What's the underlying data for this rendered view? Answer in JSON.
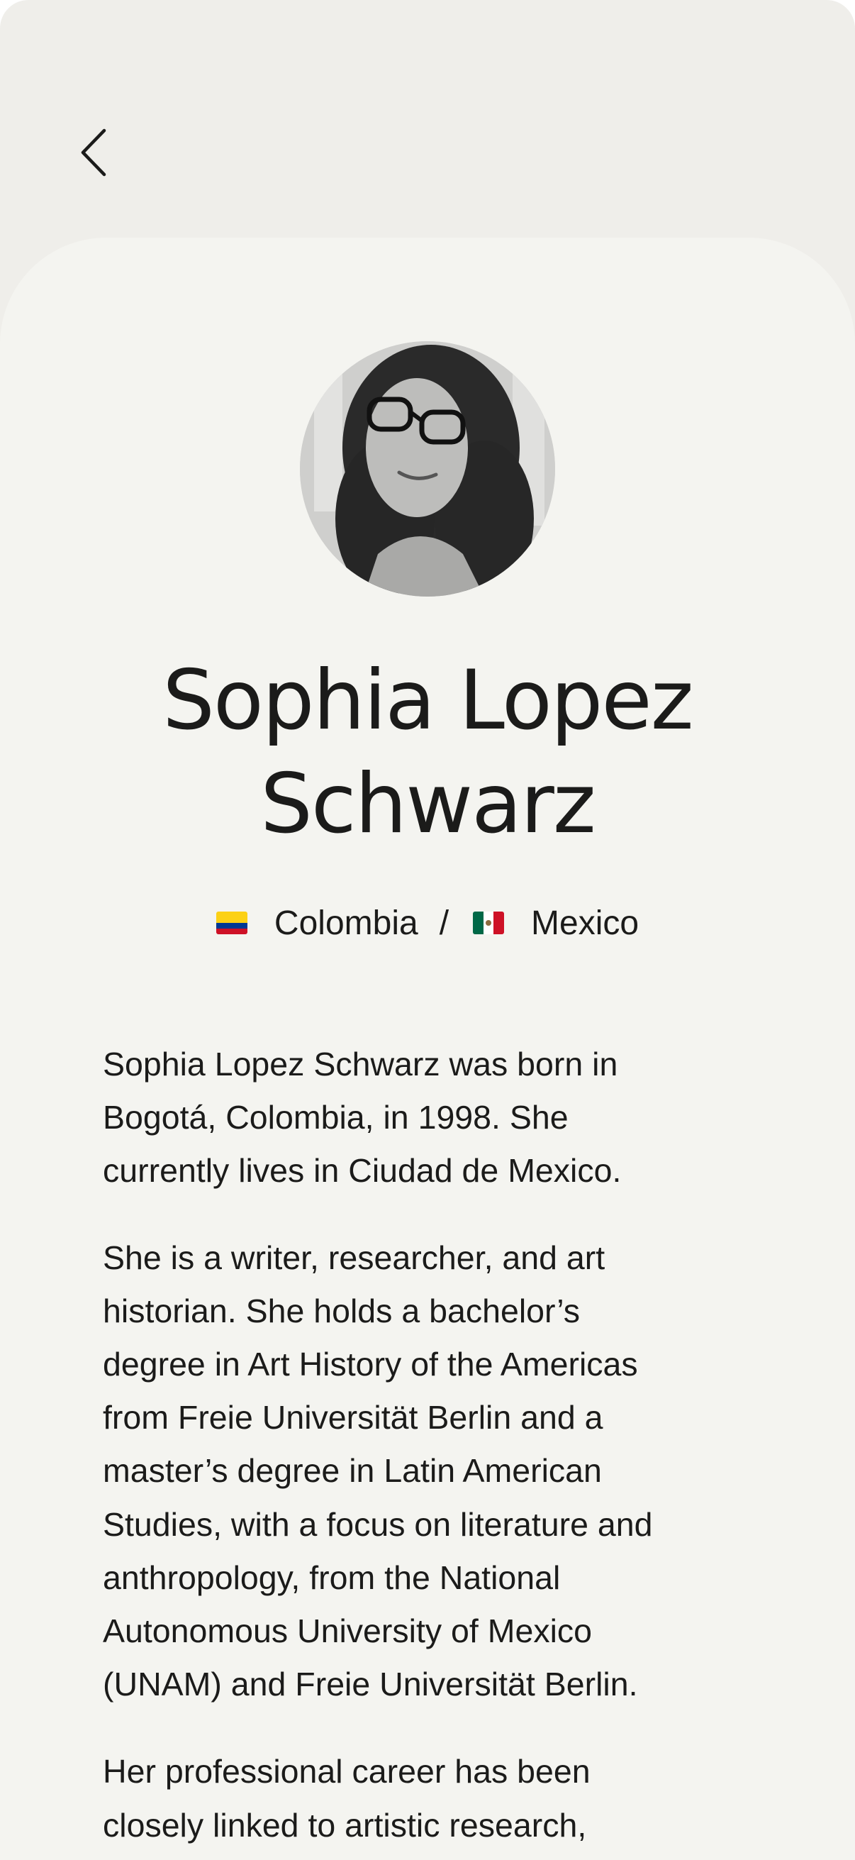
{
  "profile": {
    "name_line1": "Sophia Lopez",
    "name_line2": "Schwarz",
    "countries": [
      {
        "flag_icon": "colombia-flag-icon",
        "name": "Colombia"
      },
      {
        "flag_icon": "mexico-flag-icon",
        "name": "Mexico"
      }
    ],
    "country_separator": "/"
  },
  "bio": {
    "paragraph1": [
      "Sophia Lopez Schwarz was born in",
      "Bogotá, Colombia, in 1998. She",
      "currently lives in Ciudad de Mexico."
    ],
    "paragraph2": [
      "She is a writer, researcher, and art",
      "historian. She holds a bachelor’s",
      "degree in Art History of the Americas",
      "from Freie Universität Berlin and a",
      "master’s degree in Latin American",
      "Studies, with a focus on literature and",
      "anthropology, from the National",
      "Autonomous University of Mexico",
      "(UNAM) and Freie Universität Berlin."
    ],
    "paragraph3": [
      "Her professional career has been",
      "closely linked to artistic research,"
    ]
  },
  "nav": {
    "back_icon": "chevron-left-icon"
  },
  "colors": {
    "background": "#efeeea",
    "sheet": "#f4f4f0",
    "text": "#1b1b1a"
  }
}
